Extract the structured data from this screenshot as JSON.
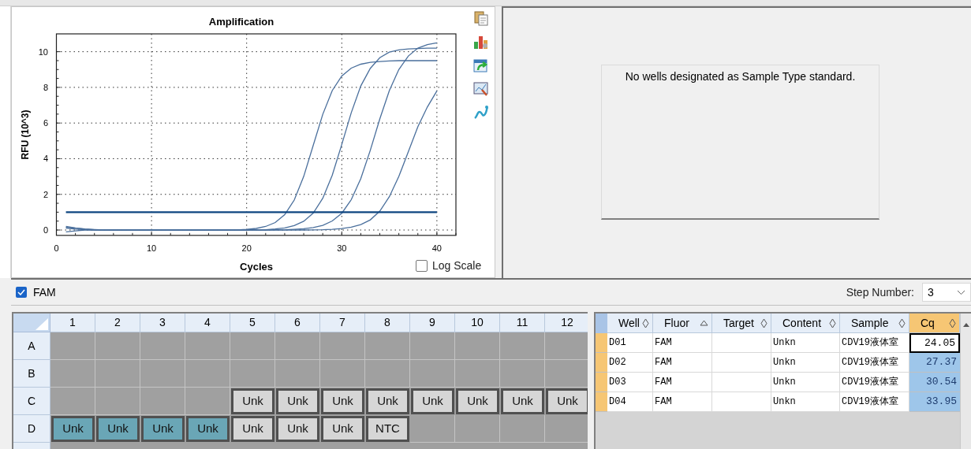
{
  "amplification_chart": {
    "chart_data": {
      "type": "line",
      "title": "Amplification",
      "xlabel": "Cycles",
      "ylabel": "RFU (10^3)",
      "x": [
        1,
        2,
        3,
        4,
        5,
        6,
        7,
        8,
        9,
        10,
        11,
        12,
        13,
        14,
        15,
        16,
        17,
        18,
        19,
        20,
        21,
        22,
        23,
        24,
        25,
        26,
        27,
        28,
        29,
        30,
        31,
        32,
        33,
        34,
        35,
        36,
        37,
        38,
        39,
        40
      ],
      "series": [
        {
          "color": "#4a6f9c",
          "values": [
            0.2,
            0.12,
            0.06,
            0.03,
            0.01,
            0,
            0,
            0,
            0,
            0,
            0,
            0,
            0,
            0,
            0,
            0,
            0,
            0,
            0.01,
            0.04,
            0.09,
            0.2,
            0.42,
            0.86,
            1.68,
            3.0,
            4.75,
            6.49,
            7.82,
            8.64,
            9.08,
            9.3,
            9.4,
            9.45,
            9.48,
            9.5,
            9.5,
            9.5,
            9.5,
            9.5
          ]
        },
        {
          "color": "#4a6f9c",
          "values": [
            0.15,
            0.1,
            0.05,
            0.02,
            0,
            0,
            0,
            0,
            0,
            0,
            0,
            0,
            0,
            0,
            0,
            0,
            0,
            0,
            0,
            0,
            0.01,
            0.02,
            0.06,
            0.12,
            0.25,
            0.49,
            0.95,
            1.78,
            3.07,
            4.8,
            6.58,
            8.08,
            9.07,
            9.66,
            9.98,
            10.1,
            10.15,
            10.18,
            10.2,
            10.2
          ]
        },
        {
          "color": "#4a6f9c",
          "values": [
            -0.1,
            -0.05,
            0,
            0,
            0,
            0,
            0,
            0,
            0,
            0,
            0,
            0,
            0,
            0,
            0,
            0,
            0,
            0,
            0,
            0,
            0,
            0,
            0.01,
            0.02,
            0.04,
            0.07,
            0.14,
            0.26,
            0.51,
            0.94,
            1.7,
            2.88,
            4.48,
            6.23,
            7.82,
            9.0,
            9.76,
            10.2,
            10.4,
            10.5
          ]
        },
        {
          "color": "#4a6f9c",
          "values": [
            0.1,
            0.05,
            0.02,
            0,
            0,
            0,
            0,
            0,
            0,
            0,
            0,
            0,
            0,
            0,
            0,
            0,
            0,
            0,
            0,
            0,
            0,
            0,
            0,
            0,
            0,
            0,
            0.01,
            0.02,
            0.04,
            0.08,
            0.16,
            0.3,
            0.57,
            1.06,
            1.87,
            3.0,
            4.4,
            5.8,
            6.9,
            7.8
          ]
        },
        {
          "color": "#0d4580",
          "values": [
            1,
            1,
            1,
            1,
            1,
            1,
            1,
            1,
            1,
            1,
            1,
            1,
            1,
            1,
            1,
            1,
            1,
            1,
            1,
            1,
            1,
            1,
            1,
            1,
            1,
            1,
            1,
            1,
            1,
            1,
            1,
            1,
            1,
            1,
            1,
            1,
            1,
            1,
            1,
            1
          ]
        }
      ],
      "grid": true,
      "xlim": [
        0,
        42
      ],
      "ylim": [
        -0.3,
        11
      ],
      "xticks": [
        0,
        10,
        20,
        30,
        40
      ],
      "yticks": [
        0,
        2,
        4,
        6,
        8,
        10
      ]
    }
  },
  "log_scale": {
    "label": "Log Scale",
    "checked": false
  },
  "standard_curve_panel": {
    "message": "No wells designated as Sample Type standard."
  },
  "fluor_filter": {
    "label": "FAM",
    "checked": true
  },
  "step_number": {
    "label": "Step Number:",
    "value": "3"
  },
  "plate": {
    "columns": [
      "1",
      "2",
      "3",
      "4",
      "5",
      "6",
      "7",
      "8",
      "9",
      "10",
      "11",
      "12"
    ],
    "rows": [
      {
        "label": "A",
        "wells": [
          {
            "kind": "empty",
            "selected": false
          },
          {
            "kind": "empty",
            "selected": false
          },
          {
            "kind": "empty",
            "selected": false
          },
          {
            "kind": "empty",
            "selected": false
          },
          {
            "kind": "empty",
            "selected": false
          },
          {
            "kind": "empty",
            "selected": false
          },
          {
            "kind": "empty",
            "selected": false
          },
          {
            "kind": "empty",
            "selected": false
          },
          {
            "kind": "empty",
            "selected": false
          },
          {
            "kind": "empty",
            "selected": false
          },
          {
            "kind": "empty",
            "selected": false
          },
          {
            "kind": "empty",
            "selected": false
          }
        ]
      },
      {
        "label": "B",
        "wells": [
          {
            "kind": "empty",
            "selected": false
          },
          {
            "kind": "empty",
            "selected": false
          },
          {
            "kind": "empty",
            "selected": false
          },
          {
            "kind": "empty",
            "selected": false
          },
          {
            "kind": "empty",
            "selected": false
          },
          {
            "kind": "empty",
            "selected": false
          },
          {
            "kind": "empty",
            "selected": false
          },
          {
            "kind": "empty",
            "selected": false
          },
          {
            "kind": "empty",
            "selected": false
          },
          {
            "kind": "empty",
            "selected": false
          },
          {
            "kind": "empty",
            "selected": false
          },
          {
            "kind": "empty",
            "selected": false
          }
        ]
      },
      {
        "label": "C",
        "wells": [
          {
            "kind": "empty",
            "selected": false
          },
          {
            "kind": "empty",
            "selected": false
          },
          {
            "kind": "empty",
            "selected": false
          },
          {
            "kind": "empty",
            "selected": false
          },
          {
            "kind": "sample",
            "content": "Unk",
            "selected": false
          },
          {
            "kind": "sample",
            "content": "Unk",
            "selected": false
          },
          {
            "kind": "sample",
            "content": "Unk",
            "selected": false
          },
          {
            "kind": "sample",
            "content": "Unk",
            "selected": false
          },
          {
            "kind": "sample",
            "content": "Unk",
            "selected": false
          },
          {
            "kind": "sample",
            "content": "Unk",
            "selected": false
          },
          {
            "kind": "sample",
            "content": "Unk",
            "selected": false
          },
          {
            "kind": "sample",
            "content": "Unk",
            "selected": false
          }
        ]
      },
      {
        "label": "D",
        "wells": [
          {
            "kind": "sample",
            "content": "Unk",
            "selected": true
          },
          {
            "kind": "sample",
            "content": "Unk",
            "selected": true
          },
          {
            "kind": "sample",
            "content": "Unk",
            "selected": true
          },
          {
            "kind": "sample",
            "content": "Unk",
            "selected": true
          },
          {
            "kind": "sample",
            "content": "Unk",
            "selected": false
          },
          {
            "kind": "sample",
            "content": "Unk",
            "selected": false
          },
          {
            "kind": "sample",
            "content": "Unk",
            "selected": false
          },
          {
            "kind": "sample",
            "content": "NTC",
            "selected": false
          },
          {
            "kind": "empty",
            "selected": false
          },
          {
            "kind": "empty",
            "selected": false
          },
          {
            "kind": "empty",
            "selected": false
          },
          {
            "kind": "empty",
            "selected": false
          }
        ]
      }
    ]
  },
  "results_table": {
    "columns": [
      {
        "label": "Well",
        "sorted": false,
        "selected": false
      },
      {
        "label": "Fluor",
        "sorted": true,
        "selected": false
      },
      {
        "label": "Target",
        "sorted": false,
        "selected": false
      },
      {
        "label": "Content",
        "sorted": false,
        "selected": false
      },
      {
        "label": "Sample",
        "sorted": false,
        "selected": false
      },
      {
        "label": "Cq",
        "sorted": false,
        "selected": true
      }
    ],
    "rows": [
      {
        "well": "D01",
        "fluor": "FAM",
        "content": "Unkn",
        "sample": "CDV19液体室",
        "cq": "24.05",
        "selected": true,
        "focused": true
      },
      {
        "well": "D02",
        "fluor": "FAM",
        "content": "Unkn",
        "sample": "CDV19液体室",
        "cq": "27.37",
        "selected": true,
        "focused": false
      },
      {
        "well": "D03",
        "fluor": "FAM",
        "content": "Unkn",
        "sample": "CDV19液体室",
        "cq": "30.54",
        "selected": true,
        "focused": false
      },
      {
        "well": "D04",
        "fluor": "FAM",
        "content": "Unkn",
        "sample": "CDV19液体室",
        "cq": "33.95",
        "selected": true,
        "focused": false
      }
    ]
  }
}
